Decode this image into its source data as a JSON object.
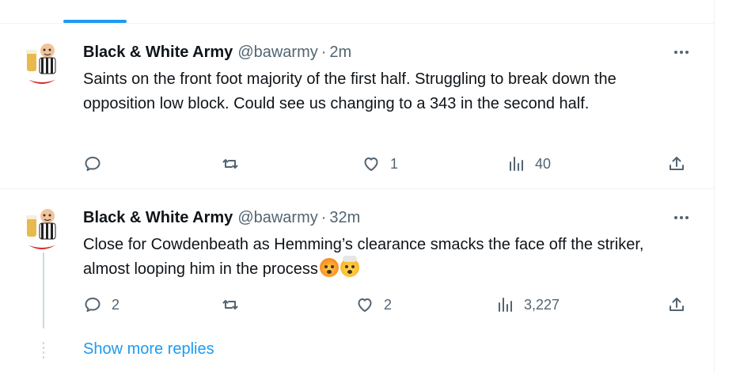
{
  "tweets": [
    {
      "author_name": "Black & White Army",
      "handle": "@bawarmy",
      "separator": "·",
      "time": "2m",
      "text": "Saints on the front foot majority of the first half. Struggling to break down the opposition low block. Could see us changing to a 343 in the second half.",
      "emojis": [],
      "reply_count": "",
      "retweet_count": "",
      "like_count": "1",
      "view_count": "40"
    },
    {
      "author_name": "Black & White Army",
      "handle": "@bawarmy",
      "separator": "·",
      "time": "32m",
      "text": "Close for Cowdenbeath as Hemming’s clearance smacks the face off the striker, almost looping him in the process",
      "emojis": [
        "hot-face-emoji",
        "exploding-head-emoji"
      ],
      "reply_count": "2",
      "retweet_count": "",
      "like_count": "2",
      "view_count": "3,227"
    }
  ],
  "show_more_replies": "Show more replies",
  "colors": {
    "accent": "#1d9bf0",
    "text": "#0f1419",
    "secondary": "#536471",
    "border": "#eff3f4"
  }
}
